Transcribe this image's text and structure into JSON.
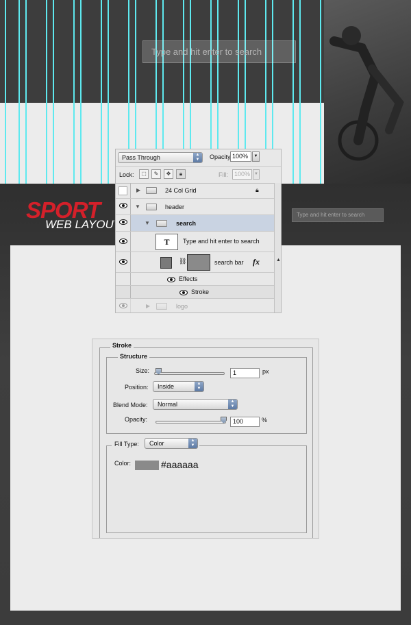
{
  "top_canvas": {
    "search_placeholder": "Type and hit enter to search",
    "guide_color": "#5ee9ef"
  },
  "site": {
    "logo_main": "SPORT",
    "logo_sub": "WEB LAYOUT",
    "search_placeholder": "Type and hit enter to search",
    "brand_color": "#d4202a"
  },
  "layers_panel": {
    "blend_mode": "Pass Through",
    "opacity_label": "Opacity:",
    "opacity_value": "100%",
    "lock_label": "Lock:",
    "fill_label": "Fill:",
    "fill_value": "100%",
    "layers": [
      {
        "name": "24 Col Grid",
        "visible": false,
        "locked": true,
        "kind": "group",
        "expanded": false
      },
      {
        "name": "header",
        "visible": true,
        "kind": "group",
        "expanded": true
      },
      {
        "name": "search",
        "visible": true,
        "kind": "group",
        "expanded": true,
        "selected": true
      },
      {
        "name": "Type and hit enter to search",
        "visible": true,
        "kind": "text",
        "thumb": "T"
      },
      {
        "name": "search bar",
        "visible": true,
        "kind": "shape",
        "fx": "fx"
      },
      {
        "name": "Effects",
        "visible": true,
        "kind": "effects"
      },
      {
        "name": "Stroke",
        "visible": true,
        "kind": "effect"
      },
      {
        "name": "logo",
        "visible": true,
        "kind": "group",
        "expanded": false
      }
    ]
  },
  "stroke_dialog": {
    "title": "Stroke",
    "structure_label": "Structure",
    "size_label": "Size:",
    "size_value": "1",
    "size_unit": "px",
    "size_slider": 0.01,
    "position_label": "Position:",
    "position_value": "Inside",
    "blend_label": "Blend Mode:",
    "blend_value": "Normal",
    "opacity_label": "Opacity:",
    "opacity_value": "100",
    "opacity_unit": "%",
    "opacity_slider": 1.0,
    "fill_type_label": "Fill Type:",
    "fill_type_value": "Color",
    "color_label": "Color:",
    "color_value": "#aaaaaa",
    "color_swatch": "#8a8a8a"
  }
}
